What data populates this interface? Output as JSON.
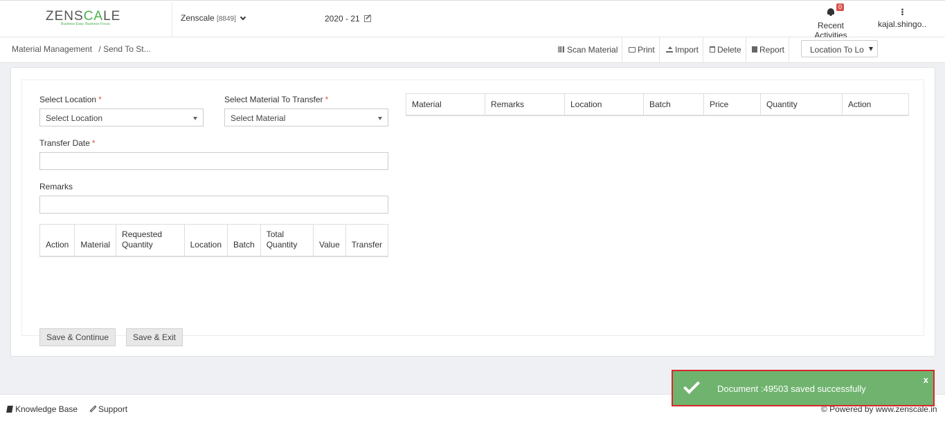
{
  "header": {
    "logo": "ZENSCALE",
    "logo_tagline": "Business Easy. Business Focus.",
    "company_name": "Zenscale",
    "company_code": "[8849]",
    "fiscal_year": "2020 - 21",
    "notification_count": "0",
    "recent_activities_label": "Recent Activities",
    "user_name": "kajal.shingo.."
  },
  "breadcrumb": {
    "root": "Material Management",
    "current": "/ Send To St..."
  },
  "toolbar": {
    "scan_material": "Scan Material",
    "print": "Print",
    "import": "Import",
    "delete": "Delete",
    "report": "Report",
    "location_filter": "Location To Lo"
  },
  "form": {
    "select_location_label": "Select Location",
    "select_location_placeholder": "Select Location",
    "select_material_label": "Select Material To Transfer",
    "select_material_placeholder": "Select Material",
    "transfer_date_label": "Transfer Date",
    "transfer_date_value": "",
    "remarks_label": "Remarks",
    "remarks_value": "",
    "required_mark": "*"
  },
  "transfer_table": {
    "columns": [
      "Action",
      "Material",
      "Requested Quantity",
      "Location",
      "Batch",
      "Total Quantity",
      "Value",
      "Transfer"
    ]
  },
  "material_table": {
    "columns": [
      "Material",
      "Remarks",
      "Location",
      "Batch",
      "Price",
      "Quantity",
      "Action"
    ]
  },
  "buttons": {
    "save_continue": "Save & Continue",
    "save_exit": "Save & Exit"
  },
  "footer": {
    "knowledge_base": "Knowledge Base",
    "support": "Support",
    "powered_by": "© Powered by www.zenscale.in"
  },
  "toast": {
    "message": "Document :49503 saved successfully",
    "close": "x"
  },
  "colors": {
    "toast_bg": "#6fb36f",
    "toast_border": "#d9262b",
    "required": "#d9534f",
    "brand_green": "#4caf50"
  }
}
